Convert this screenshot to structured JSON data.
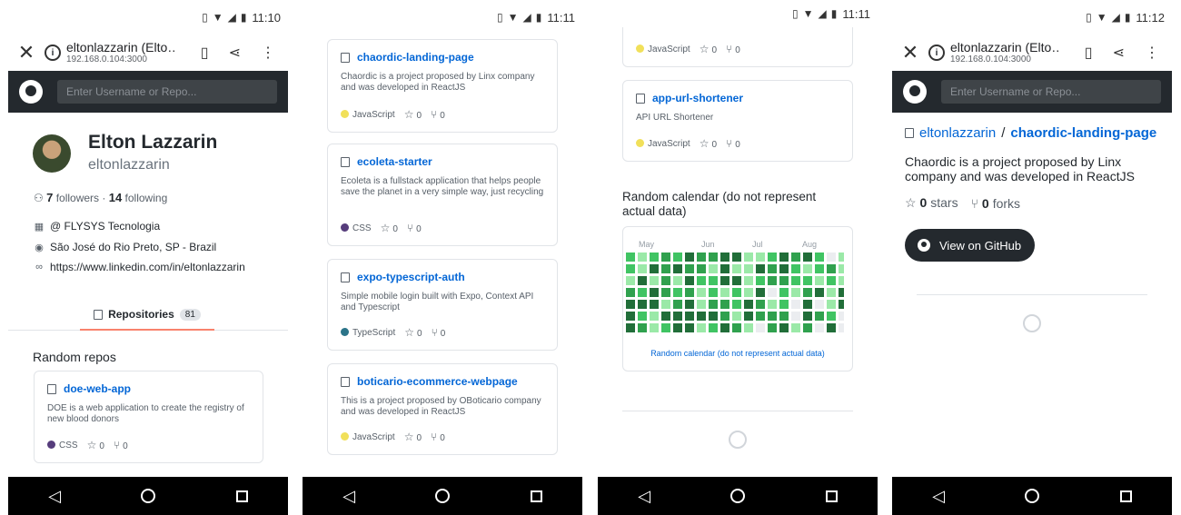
{
  "status": [
    {
      "time": "11:10"
    },
    {
      "time": "11:11"
    },
    {
      "time": "11:11"
    },
    {
      "time": "11:12"
    }
  ],
  "browser": {
    "title": "eltonlazzarin (Elto…",
    "url": "192.168.0.104:3000"
  },
  "search": {
    "placeholder": "Enter Username or Repo..."
  },
  "profile": {
    "name": "Elton Lazzarin",
    "login": "eltonlazzarin",
    "followers": "7",
    "followers_label": "followers",
    "separator": "·",
    "following": "14",
    "following_label": "following",
    "company": "@ FLYSYS Tecnologia",
    "location": "São José do Rio Preto, SP - Brazil",
    "website": "https://www.linkedin.com/in/eltonlazzarin",
    "tab_label": "Repositories",
    "repo_count": "81",
    "random_repos_title": "Random repos"
  },
  "repos": [
    {
      "name": "doe-web-app",
      "desc": "DOE is a web application to create the registry of new blood donors",
      "lang": "CSS",
      "lang_color": "#563d7c",
      "stars": "0",
      "forks": "0"
    },
    {
      "name": "chaordic-landing-page",
      "desc": "Chaordic is a project proposed by Linx company and was developed in ReactJS",
      "lang": "JavaScript",
      "lang_color": "#f1e05a",
      "stars": "0",
      "forks": "0"
    },
    {
      "name": "ecoleta-starter",
      "desc": "Ecoleta is a fullstack application that helps people save the planet in a very simple way, just recycling",
      "lang": "CSS",
      "lang_color": "#563d7c",
      "stars": "0",
      "forks": "0"
    },
    {
      "name": "expo-typescript-auth",
      "desc": "Simple mobile login built with Expo, Context API and Typescript",
      "lang": "TypeScript",
      "lang_color": "#2b7489",
      "stars": "0",
      "forks": "0"
    },
    {
      "name": "boticario-ecommerce-webpage",
      "desc": "This is a project proposed by OBoticario company and was developed in ReactJS",
      "lang": "JavaScript",
      "lang_color": "#f1e05a",
      "stars": "0",
      "forks": "0"
    },
    {
      "name": "app-url-shortener",
      "desc": "API URL Shortener",
      "lang": "JavaScript",
      "lang_color": "#f1e05a",
      "stars": "0",
      "forks": "0"
    }
  ],
  "partial_card": {
    "lang": "JavaScript",
    "lang_color": "#f1e05a",
    "stars": "0",
    "forks": "0"
  },
  "calendar": {
    "title": "Random calendar (do not represent actual data)",
    "months": [
      "May",
      "Jun",
      "Jul",
      "Aug"
    ],
    "link": "Random calendar (do not represent actual data)",
    "colors": [
      "#ebedf0",
      "#9be9a8",
      "#40c463",
      "#30a14e",
      "#216e39"
    ],
    "weeks": [
      [
        2,
        2,
        1,
        3,
        4,
        4,
        4
      ],
      [
        1,
        1,
        4,
        2,
        4,
        2,
        3
      ],
      [
        2,
        4,
        1,
        4,
        4,
        1,
        1
      ],
      [
        3,
        3,
        3,
        3,
        1,
        4,
        2
      ],
      [
        2,
        4,
        1,
        2,
        3,
        4,
        4
      ],
      [
        4,
        3,
        4,
        3,
        4,
        4,
        4
      ],
      [
        3,
        3,
        2,
        1,
        1,
        4,
        1
      ],
      [
        3,
        1,
        2,
        2,
        3,
        4,
        2
      ],
      [
        4,
        4,
        4,
        1,
        3,
        3,
        4
      ],
      [
        4,
        1,
        4,
        2,
        2,
        1,
        3
      ],
      [
        1,
        1,
        1,
        1,
        4,
        4,
        1
      ],
      [
        1,
        4,
        2,
        4,
        3,
        3,
        0
      ],
      [
        2,
        3,
        3,
        0,
        1,
        3,
        3
      ],
      [
        4,
        4,
        3,
        2,
        2,
        3,
        4
      ],
      [
        3,
        2,
        2,
        1,
        0,
        0,
        1
      ],
      [
        4,
        1,
        2,
        3,
        4,
        4,
        3
      ],
      [
        2,
        2,
        1,
        4,
        0,
        3,
        0
      ],
      [
        0,
        3,
        2,
        1,
        1,
        2,
        4
      ],
      [
        1,
        1,
        1,
        4,
        4,
        0,
        0
      ]
    ]
  },
  "repo_page": {
    "owner": "eltonlazzarin",
    "sep": "/",
    "repo": "chaordic-landing-page",
    "desc": "Chaordic is a project proposed by Linx company and was developed in ReactJS",
    "stars": "0",
    "stars_label": "stars",
    "forks": "0",
    "forks_label": "forks",
    "button": "View on GitHub"
  },
  "colors": {
    "header": "#24292e",
    "link": "#0366d6",
    "tab_underline": "#f9826c"
  }
}
